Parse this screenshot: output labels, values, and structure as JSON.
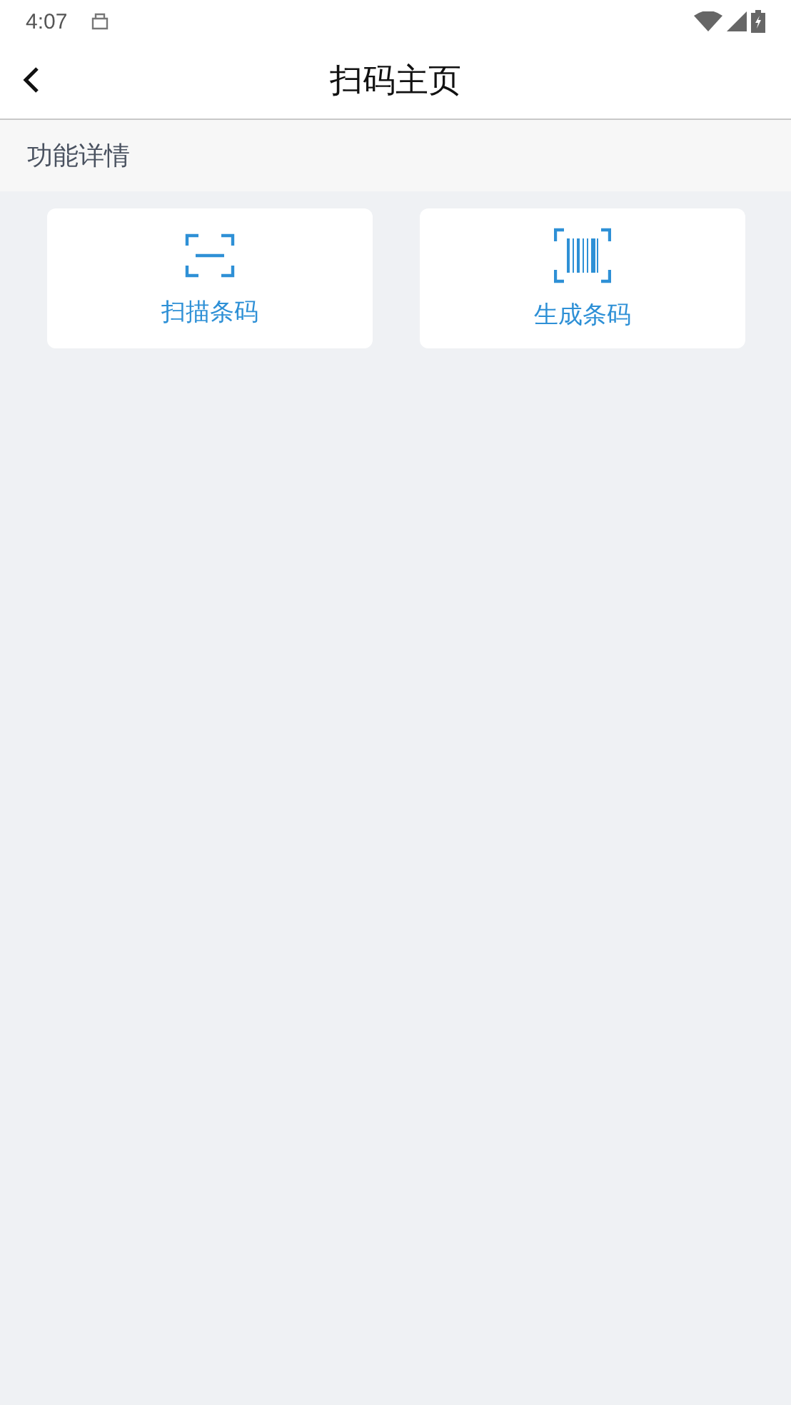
{
  "status_bar": {
    "time": "4:07"
  },
  "header": {
    "title": "扫码主页"
  },
  "section": {
    "title": "功能详情"
  },
  "actions": [
    {
      "kind": "scan",
      "label": "扫描条码"
    },
    {
      "kind": "barcode",
      "label": "生成条码"
    }
  ]
}
